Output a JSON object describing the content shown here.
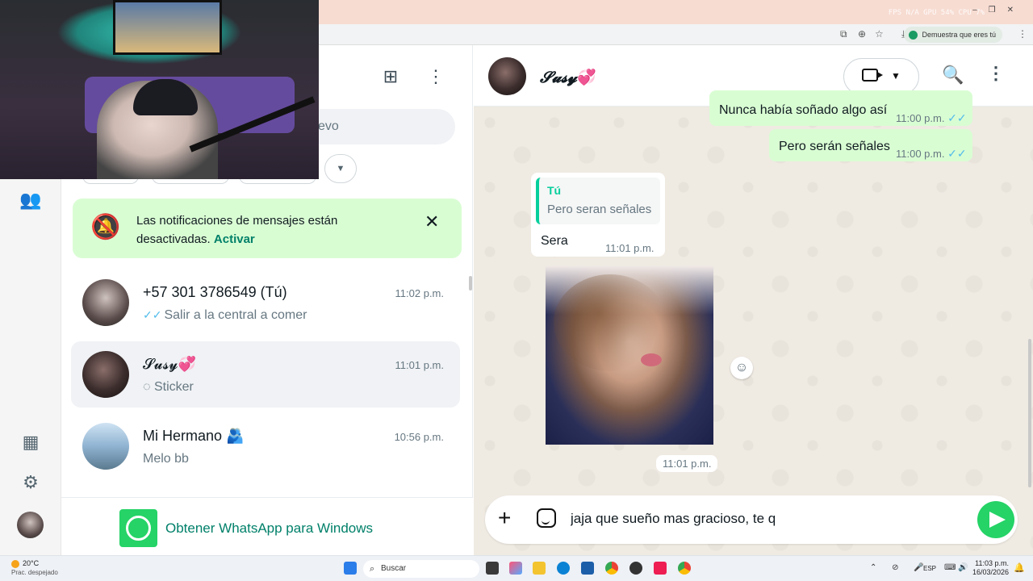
{
  "browser": {
    "perf_stats": "FPS N/A   GPU 54%   CPU 7%",
    "verify_chip": "Demuestra que eres tú"
  },
  "left_rail": {
    "items": [
      {
        "icon": "communities-icon"
      },
      {
        "icon": "media-icon"
      },
      {
        "icon": "settings-icon"
      }
    ]
  },
  "chat_list": {
    "search_partial": "evo",
    "notification": {
      "text": "Las notificaciones de mensajes están desactivadas.",
      "action": "Activar"
    },
    "chats": [
      {
        "name": "+57 301 3786549 (Tú)",
        "time": "11:02 p.m.",
        "preview": "Salir a la central a comer",
        "read_ticks": "✓✓"
      },
      {
        "name": "𝓢𝓾𝓼𝔂",
        "heart": "💞",
        "time": "11:01 p.m.",
        "preview": "Sticker",
        "selected": true
      },
      {
        "name": "Mi Hermano",
        "emoji": "🫂",
        "time": "10:56 p.m.",
        "preview": "Melo bb"
      }
    ],
    "get_app_label": "Obtener WhatsApp para Windows"
  },
  "conversation": {
    "contact_name": "𝓢𝓾𝓼𝔂",
    "contact_heart": "💞",
    "messages": [
      {
        "direction": "out",
        "text": "Nunca había soñado algo así",
        "time": "11:00 p.m.",
        "ticks": "✓✓"
      },
      {
        "direction": "out",
        "text": "Pero serán señales",
        "time": "11:00 p.m.",
        "ticks": "✓✓"
      },
      {
        "direction": "in",
        "quote_author": "Tú",
        "quote_text": "Pero seran señales",
        "text": "Sera",
        "time": "11:01 p.m."
      },
      {
        "direction": "in",
        "type": "sticker",
        "time": "11:01 p.m."
      }
    ],
    "composer_value": "jaja que sueño mas gracioso, te q"
  },
  "taskbar": {
    "weather_temp": "20°C",
    "weather_desc": "Prac. despejado",
    "search_label": "Buscar",
    "lang": "ESP",
    "time": "11:03 p.m.",
    "date": "16/03/2026"
  }
}
